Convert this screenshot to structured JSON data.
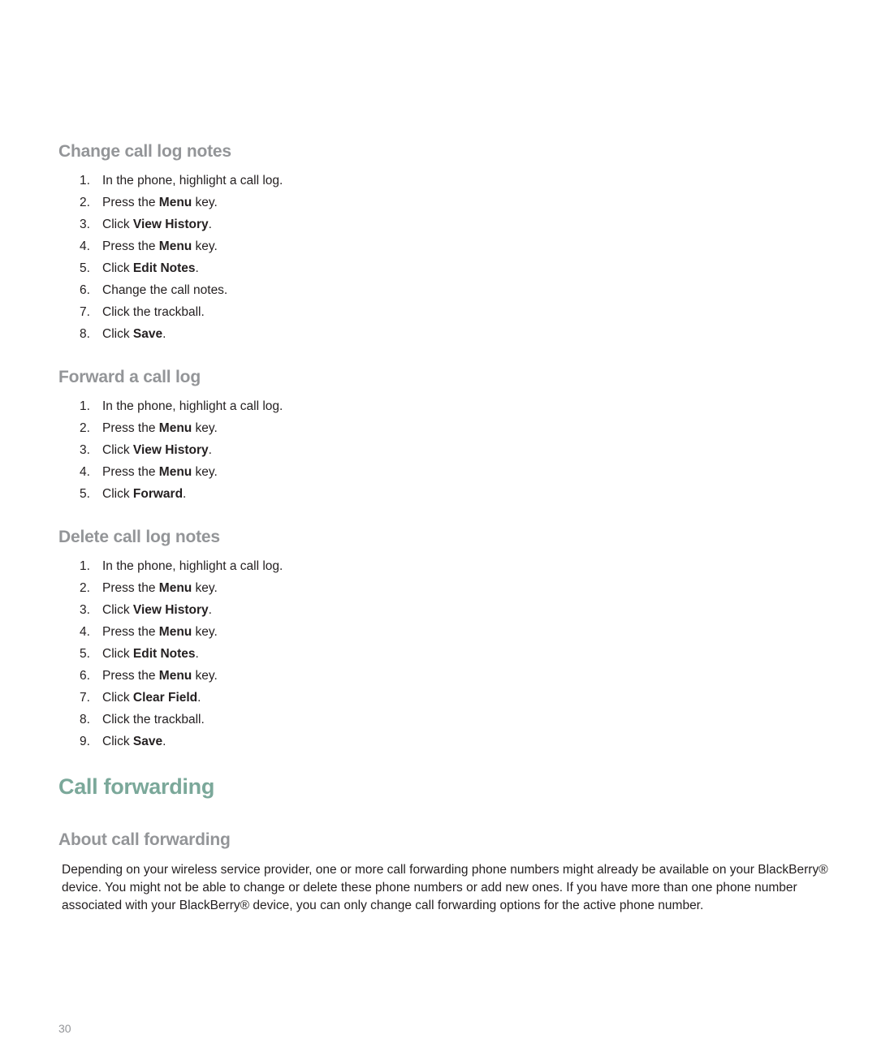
{
  "sections": [
    {
      "heading": "Change call log notes",
      "steps": [
        {
          "num": "1.",
          "pre": "In the phone, highlight a call log.",
          "bold": "",
          "post": ""
        },
        {
          "num": "2.",
          "pre": "Press the ",
          "bold": "Menu",
          "post": " key."
        },
        {
          "num": "3.",
          "pre": "Click ",
          "bold": "View History",
          "post": "."
        },
        {
          "num": "4.",
          "pre": "Press the ",
          "bold": "Menu",
          "post": " key."
        },
        {
          "num": "5.",
          "pre": "Click ",
          "bold": "Edit Notes",
          "post": "."
        },
        {
          "num": "6.",
          "pre": "Change the call notes.",
          "bold": "",
          "post": ""
        },
        {
          "num": "7.",
          "pre": "Click the trackball.",
          "bold": "",
          "post": ""
        },
        {
          "num": "8.",
          "pre": "Click ",
          "bold": "Save",
          "post": "."
        }
      ]
    },
    {
      "heading": "Forward a call log",
      "steps": [
        {
          "num": "1.",
          "pre": "In the phone, highlight a call log.",
          "bold": "",
          "post": ""
        },
        {
          "num": "2.",
          "pre": "Press the ",
          "bold": "Menu",
          "post": " key."
        },
        {
          "num": "3.",
          "pre": "Click ",
          "bold": "View History",
          "post": "."
        },
        {
          "num": "4.",
          "pre": "Press the ",
          "bold": "Menu",
          "post": " key."
        },
        {
          "num": "5.",
          "pre": "Click ",
          "bold": "Forward",
          "post": "."
        }
      ]
    },
    {
      "heading": "Delete call log notes",
      "steps": [
        {
          "num": "1.",
          "pre": "In the phone, highlight a call log.",
          "bold": "",
          "post": ""
        },
        {
          "num": "2.",
          "pre": "Press the ",
          "bold": "Menu",
          "post": " key."
        },
        {
          "num": "3.",
          "pre": "Click ",
          "bold": "View History",
          "post": "."
        },
        {
          "num": "4.",
          "pre": "Press the ",
          "bold": "Menu",
          "post": " key."
        },
        {
          "num": "5.",
          "pre": "Click ",
          "bold": "Edit Notes",
          "post": "."
        },
        {
          "num": "6.",
          "pre": "Press the ",
          "bold": "Menu",
          "post": " key."
        },
        {
          "num": "7.",
          "pre": "Click ",
          "bold": "Clear Field",
          "post": "."
        },
        {
          "num": "8.",
          "pre": "Click the trackball.",
          "bold": "",
          "post": ""
        },
        {
          "num": "9.",
          "pre": "Click ",
          "bold": "Save",
          "post": "."
        }
      ]
    }
  ],
  "chapter_title": "Call forwarding",
  "about": {
    "heading": "About call forwarding",
    "lines": [
      "Depending on your wireless service provider, one or more call forwarding phone numbers might already be available on your BlackBerry®",
      "device. You might not be able to change or delete these phone numbers or add new ones. If you have more than one phone number",
      "associated with your BlackBerry® device, you can only change call forwarding options for the active phone number."
    ]
  },
  "page_number": "30",
  "colors": {
    "chapter_title": "#7ba89a",
    "section_heading": "#939598",
    "body_text": "#231f20"
  }
}
